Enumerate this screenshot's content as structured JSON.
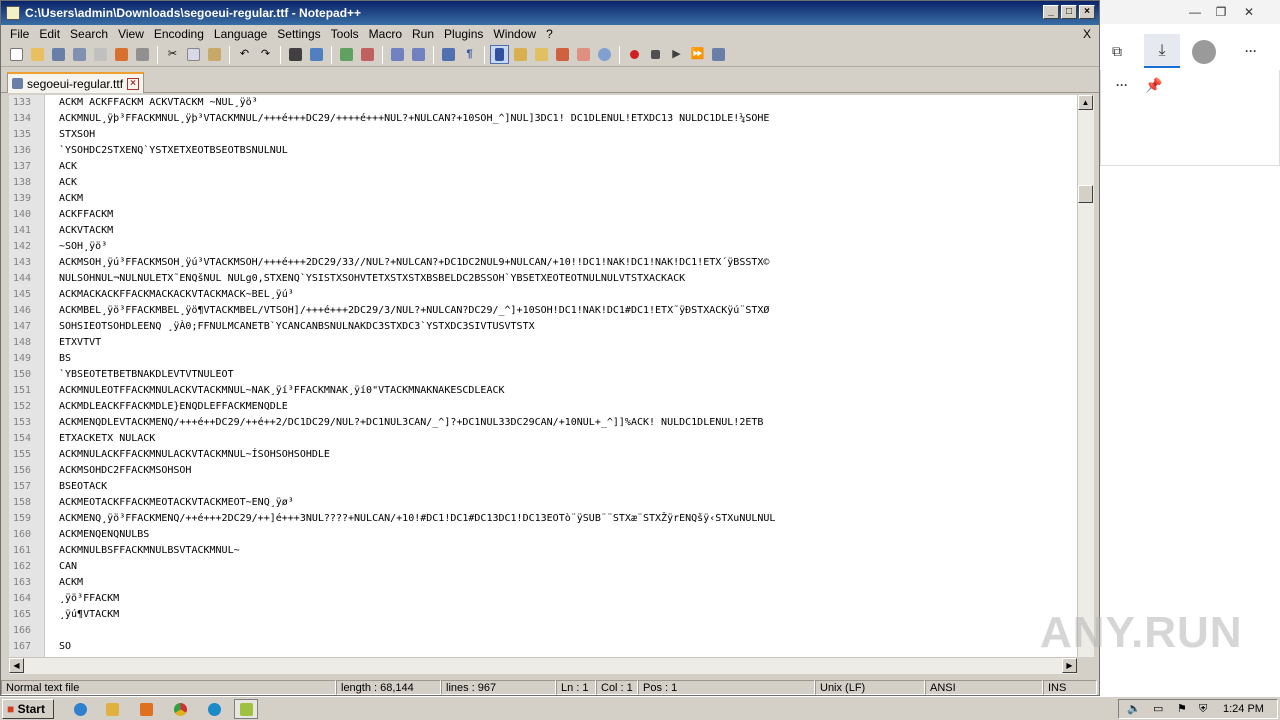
{
  "window": {
    "title": "C:\\Users\\admin\\Downloads\\segoeui-regular.ttf - Notepad++",
    "buttons": [
      "_",
      "□",
      "×"
    ]
  },
  "menu": {
    "items": [
      "File",
      "Edit",
      "Search",
      "View",
      "Encoding",
      "Language",
      "Settings",
      "Tools",
      "Macro",
      "Run",
      "Plugins",
      "Window",
      "?"
    ],
    "close": "X"
  },
  "tab": {
    "label": "segoeui-regular.ttf",
    "close": "×"
  },
  "toolbar": {
    "icons": [
      "new-file-icon",
      "open-file-icon",
      "save-icon",
      "save-all-icon",
      "close-icon",
      "close-all-icon",
      "print-icon",
      "cut-icon",
      "copy-icon",
      "paste-icon",
      "undo-icon",
      "redo-icon",
      "find-icon",
      "replace-icon",
      "zoom-in-icon",
      "zoom-out-icon",
      "sync-v-icon",
      "sync-h-icon",
      "word-wrap-icon",
      "show-all-chars-icon",
      "indent-guide-icon",
      "doc-map-icon",
      "function-list-icon",
      "folder-workspace-icon",
      "monitoring-icon",
      "record-macro-icon",
      "stop-record-icon",
      "play-macro-icon",
      "run-macro-multiple-icon",
      "save-macro-icon"
    ]
  },
  "editor": {
    "lines": [
      {
        "n": "133",
        "text": "ACKM    ACKFFACKM  ACKVTACKM  ~NUL¸ÿö³"
      },
      {
        "n": "134",
        "text": "ACKMNUL¸ÿþ³FFACKMNUL¸ÿþ³VTACKMNUL/+++é+++DC29/++++é+++NUL?+NULCAN?+10SOH_^]NUL]3DC1! DC1DLENUL!ETXDC13 NULDC1DLE!¼SOHE"
      },
      {
        "n": "135",
        "text": "STXSOH"
      },
      {
        "n": "136",
        "text": "`YSOHDC2STXENQ`YSTXETXEOTBSEOTBSNULNUL"
      },
      {
        "n": "137",
        "text": "ACK"
      },
      {
        "n": "138",
        "text": "ACK"
      },
      {
        "n": "139",
        "text": "ACKM"
      },
      {
        "n": "140",
        "text": "ACKFFACKM"
      },
      {
        "n": "141",
        "text": "ACKVTACKM"
      },
      {
        "n": "142",
        "text": "~SOH¸ÿö³"
      },
      {
        "n": "143",
        "text": "ACKMSOH¸ÿú³FFACKMSOH¸ÿú³VTACKMSOH/+++é+++2DC29/33//NUL?+NULCAN?+DC1DC2NUL9+NULCAN/+10!!DC1!NAK!DC1!NAK!DC1!ETX´ÿBSSTX©"
      },
      {
        "n": "144",
        "text": "NULSOHNUL¬NULNULETX˜ENQšNUL  NULg0,STXENQ`YSISTXSOHVTETXSTXSTXBSBELDC2BSSOH`YBSETXEOTEOTNULNULVTSTXACKACK"
      },
      {
        "n": "145",
        "text": "ACKMACKACKFFACKMACKACKVTACKMACK~BEL¸ÿú³"
      },
      {
        "n": "146",
        "text": "ACKMBEL¸ÿö³FFACKMBEL¸ÿö¶VTACKMBEL/VTSOH]/+++é+++2DC29/3/NUL?+NULCAN?DC29/_^]+10SOH!DC1!NAK!DC1#DC1!ETX˜ÿÐSTXACKÿú¨STXØ"
      },
      {
        "n": "147",
        "text": "SOHSIEOTSOHDLEENQ ¸ÿÀ0;FFNULMCANETB`YCANCANBSNULNAKDC3STXDC3`YSTXDC3SIVTUSVTSTX"
      },
      {
        "n": "148",
        "text": "ETXVTVT"
      },
      {
        "n": "149",
        "text": "BS"
      },
      {
        "n": "150",
        "text": "`YBSEOTETBETBNAKDLEVTVTNULEOT"
      },
      {
        "n": "151",
        "text": "ACKMNULEOTFFACKMNULACKVTACKMNUL~NAK¸ÿí³FFACKMNAK¸ÿí0\"VTACKMNAKNAKESCDLEACK"
      },
      {
        "n": "152",
        "text": "ACKMDLEACKFFACKMDLE}ENQDLEFFACKMENQDLE"
      },
      {
        "n": "153",
        "text": "ACKMENQDLEVTACKMENQ/+++é++DC29/++é++2/DC1DC29/NUL?+DC1NUL3CAN/_^]?+DC1NUL33DC29CAN/+10NUL+_^]]%ACK! NULDC1DLENUL!2ETB"
      },
      {
        "n": "154",
        "text": "ETXACKETX  NULACK"
      },
      {
        "n": "155",
        "text": "ACKMNULACKFFACKMNULACKVTACKMNUL~ÍSOHSOHSOHDLE"
      },
      {
        "n": "156",
        "text": "ACKMSOHDC2FFACKMSOHSOH"
      },
      {
        "n": "157",
        "text": "BSEOTACK"
      },
      {
        "n": "158",
        "text": "ACKMEOTACKFFACKMEOTACKVTACKMEOT~ENQ¸ÿø³"
      },
      {
        "n": "159",
        "text": "ACKMENQ¸ÿö³FFACKMENQ/++é+++2DC29/++]é+++3NUL????+NULCAN/+10!#DC1!DC1#DC13DC1!DC13EOTò¨ÿSUB¨¨STXæ¨STXŽÿrENQšÿ‹STXuNULNUL"
      },
      {
        "n": "160",
        "text": "ACKMENQENQNULBS"
      },
      {
        "n": "161",
        "text": "ACKMNULBSFFACKMNULBSVTACKMNUL~"
      },
      {
        "n": "162",
        "text": "CAN"
      },
      {
        "n": "163",
        "text": "ACKM"
      },
      {
        "n": "164",
        "text": "¸ÿö³FFACKM"
      },
      {
        "n": "165",
        "text": "¸ÿú¶VTACKM"
      },
      {
        "n": "166",
        "text": ""
      },
      {
        "n": "167",
        "text": "SO"
      }
    ]
  },
  "status": {
    "type": "Normal text file",
    "length": "length : 68,144",
    "lines": "lines : 967",
    "ln": "Ln : 1",
    "col": "Col : 1",
    "pos": "Pos : 1",
    "eol": "Unix (LF)",
    "encoding": "ANSI",
    "mode": "INS"
  },
  "taskbar": {
    "start": "Start",
    "time": "1:24 PM",
    "icons": [
      "ie-icon",
      "explorer-icon",
      "media-player-icon",
      "chrome-icon",
      "edge-icon",
      "notepadpp-icon"
    ]
  },
  "browser": {
    "icons": [
      "minimize-icon",
      "restore-icon",
      "close-icon",
      "add-collection-icon",
      "download-icon",
      "profile-icon",
      "more-icon",
      "more-icon",
      "pin-icon"
    ]
  },
  "watermark": "ANY.RUN"
}
